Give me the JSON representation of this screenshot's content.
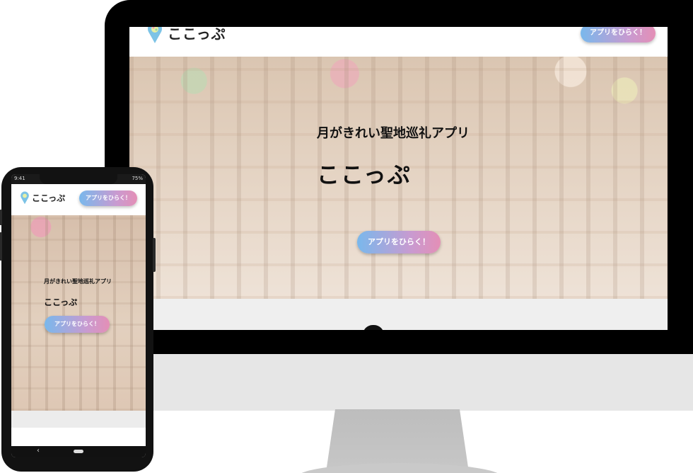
{
  "brand": {
    "logo_text": "ここっぷ",
    "accent_gradient": [
      "#79b8ec",
      "#c99ad0",
      "#e48fb6"
    ]
  },
  "desktop": {
    "header_button": "アプリをひらく！",
    "hero": {
      "subtitle": "月がきれい聖地巡礼アプリ",
      "title": "ここっぷ",
      "cta_button": "アプリをひらく！"
    }
  },
  "phone": {
    "status": {
      "time": "9:41",
      "battery": "75%"
    },
    "header_button": "アプリをひらく！",
    "hero": {
      "subtitle": "月がきれい聖地巡礼アプリ",
      "title": "ここっぷ",
      "cta_button": "アプリをひらく！"
    },
    "nav": {
      "back_icon": "‹"
    }
  }
}
